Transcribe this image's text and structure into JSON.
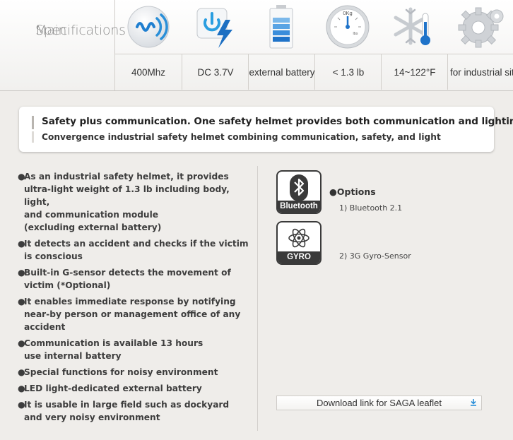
{
  "specs": {
    "title_line1": "Main",
    "title_line2": "Specifications",
    "items": [
      {
        "icon": "wireless-signal-icon",
        "label": "400Mhz"
      },
      {
        "icon": "power-bolt-icon",
        "label": "DC 3.7V"
      },
      {
        "icon": "battery-icon",
        "label": "external battery"
      },
      {
        "icon": "weight-scale-icon",
        "label": "< 1.3 lb",
        "gauge_top": "0Kg",
        "gauge_unit": "lbs"
      },
      {
        "icon": "snowflake-thermometer-icon",
        "label": "14~122°F"
      },
      {
        "icon": "gear-icon",
        "label": "for industrial site"
      }
    ]
  },
  "banner": {
    "headline": "Safety plus communication. One safety helmet provides both communication and lighting!",
    "subline": "Convergence industrial safety helmet combining communication, safety, and light"
  },
  "features": [
    "As an industrial safety helmet, it provides\nultra-light weight of 1.3 lb including body, light,\nand communication module\n(excluding external battery)",
    "It detects an accident and checks if the victim\nis conscious",
    "Built-in G-sensor detects the movement of\nvictim (*Optional)",
    "It enables immediate response by notifying\nnear-by person or management office of any\naccident",
    "Communication is available 13 hours\nuse internal battery",
    "Special functions for noisy environment",
    "LED light-dedicated external battery",
    "It is usable in large field such as dockyard\nand very noisy environment"
  ],
  "bullet": "●",
  "options": {
    "heading": "●Options",
    "items": [
      {
        "badge": "Bluetooth",
        "icon": "bluetooth-icon",
        "text": "1) Bluetooth 2.1"
      },
      {
        "badge": "GYRO",
        "icon": "gyro-atom-icon",
        "text": "2) 3G Gyro-Sensor"
      }
    ]
  },
  "download": {
    "label": "Download link for SAGA leaflet",
    "icon": "download-arrow-icon"
  },
  "colors": {
    "accent_blue": "#2a8fd8",
    "badge_dark": "#3a3a3a",
    "background": "#efedea"
  }
}
